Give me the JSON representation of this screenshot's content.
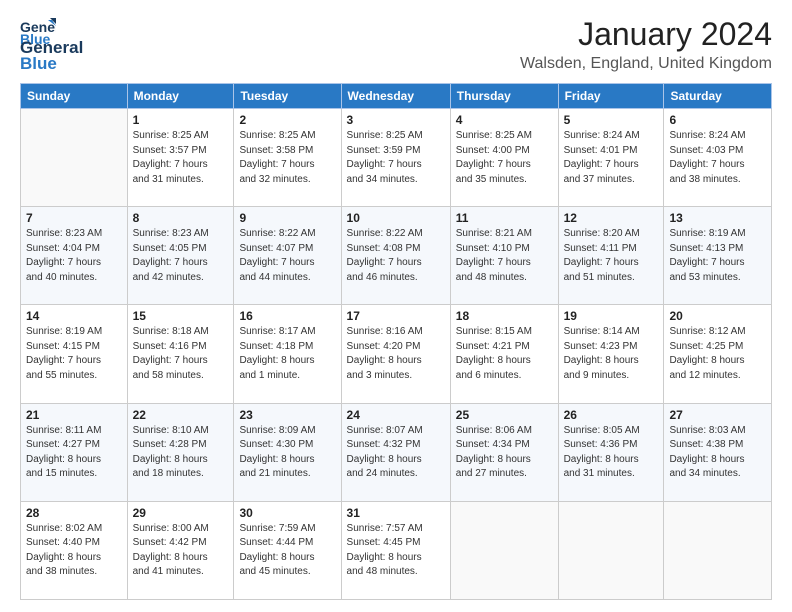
{
  "header": {
    "logo_line1": "General",
    "logo_line2": "Blue",
    "month": "January 2024",
    "location": "Walsden, England, United Kingdom"
  },
  "days_of_week": [
    "Sunday",
    "Monday",
    "Tuesday",
    "Wednesday",
    "Thursday",
    "Friday",
    "Saturday"
  ],
  "weeks": [
    [
      {
        "day": "",
        "content": ""
      },
      {
        "day": "1",
        "content": "Sunrise: 8:25 AM\nSunset: 3:57 PM\nDaylight: 7 hours\nand 31 minutes."
      },
      {
        "day": "2",
        "content": "Sunrise: 8:25 AM\nSunset: 3:58 PM\nDaylight: 7 hours\nand 32 minutes."
      },
      {
        "day": "3",
        "content": "Sunrise: 8:25 AM\nSunset: 3:59 PM\nDaylight: 7 hours\nand 34 minutes."
      },
      {
        "day": "4",
        "content": "Sunrise: 8:25 AM\nSunset: 4:00 PM\nDaylight: 7 hours\nand 35 minutes."
      },
      {
        "day": "5",
        "content": "Sunrise: 8:24 AM\nSunset: 4:01 PM\nDaylight: 7 hours\nand 37 minutes."
      },
      {
        "day": "6",
        "content": "Sunrise: 8:24 AM\nSunset: 4:03 PM\nDaylight: 7 hours\nand 38 minutes."
      }
    ],
    [
      {
        "day": "7",
        "content": "Sunrise: 8:23 AM\nSunset: 4:04 PM\nDaylight: 7 hours\nand 40 minutes."
      },
      {
        "day": "8",
        "content": "Sunrise: 8:23 AM\nSunset: 4:05 PM\nDaylight: 7 hours\nand 42 minutes."
      },
      {
        "day": "9",
        "content": "Sunrise: 8:22 AM\nSunset: 4:07 PM\nDaylight: 7 hours\nand 44 minutes."
      },
      {
        "day": "10",
        "content": "Sunrise: 8:22 AM\nSunset: 4:08 PM\nDaylight: 7 hours\nand 46 minutes."
      },
      {
        "day": "11",
        "content": "Sunrise: 8:21 AM\nSunset: 4:10 PM\nDaylight: 7 hours\nand 48 minutes."
      },
      {
        "day": "12",
        "content": "Sunrise: 8:20 AM\nSunset: 4:11 PM\nDaylight: 7 hours\nand 51 minutes."
      },
      {
        "day": "13",
        "content": "Sunrise: 8:19 AM\nSunset: 4:13 PM\nDaylight: 7 hours\nand 53 minutes."
      }
    ],
    [
      {
        "day": "14",
        "content": "Sunrise: 8:19 AM\nSunset: 4:15 PM\nDaylight: 7 hours\nand 55 minutes."
      },
      {
        "day": "15",
        "content": "Sunrise: 8:18 AM\nSunset: 4:16 PM\nDaylight: 7 hours\nand 58 minutes."
      },
      {
        "day": "16",
        "content": "Sunrise: 8:17 AM\nSunset: 4:18 PM\nDaylight: 8 hours\nand 1 minute."
      },
      {
        "day": "17",
        "content": "Sunrise: 8:16 AM\nSunset: 4:20 PM\nDaylight: 8 hours\nand 3 minutes."
      },
      {
        "day": "18",
        "content": "Sunrise: 8:15 AM\nSunset: 4:21 PM\nDaylight: 8 hours\nand 6 minutes."
      },
      {
        "day": "19",
        "content": "Sunrise: 8:14 AM\nSunset: 4:23 PM\nDaylight: 8 hours\nand 9 minutes."
      },
      {
        "day": "20",
        "content": "Sunrise: 8:12 AM\nSunset: 4:25 PM\nDaylight: 8 hours\nand 12 minutes."
      }
    ],
    [
      {
        "day": "21",
        "content": "Sunrise: 8:11 AM\nSunset: 4:27 PM\nDaylight: 8 hours\nand 15 minutes."
      },
      {
        "day": "22",
        "content": "Sunrise: 8:10 AM\nSunset: 4:28 PM\nDaylight: 8 hours\nand 18 minutes."
      },
      {
        "day": "23",
        "content": "Sunrise: 8:09 AM\nSunset: 4:30 PM\nDaylight: 8 hours\nand 21 minutes."
      },
      {
        "day": "24",
        "content": "Sunrise: 8:07 AM\nSunset: 4:32 PM\nDaylight: 8 hours\nand 24 minutes."
      },
      {
        "day": "25",
        "content": "Sunrise: 8:06 AM\nSunset: 4:34 PM\nDaylight: 8 hours\nand 27 minutes."
      },
      {
        "day": "26",
        "content": "Sunrise: 8:05 AM\nSunset: 4:36 PM\nDaylight: 8 hours\nand 31 minutes."
      },
      {
        "day": "27",
        "content": "Sunrise: 8:03 AM\nSunset: 4:38 PM\nDaylight: 8 hours\nand 34 minutes."
      }
    ],
    [
      {
        "day": "28",
        "content": "Sunrise: 8:02 AM\nSunset: 4:40 PM\nDaylight: 8 hours\nand 38 minutes."
      },
      {
        "day": "29",
        "content": "Sunrise: 8:00 AM\nSunset: 4:42 PM\nDaylight: 8 hours\nand 41 minutes."
      },
      {
        "day": "30",
        "content": "Sunrise: 7:59 AM\nSunset: 4:44 PM\nDaylight: 8 hours\nand 45 minutes."
      },
      {
        "day": "31",
        "content": "Sunrise: 7:57 AM\nSunset: 4:45 PM\nDaylight: 8 hours\nand 48 minutes."
      },
      {
        "day": "",
        "content": ""
      },
      {
        "day": "",
        "content": ""
      },
      {
        "day": "",
        "content": ""
      }
    ]
  ]
}
